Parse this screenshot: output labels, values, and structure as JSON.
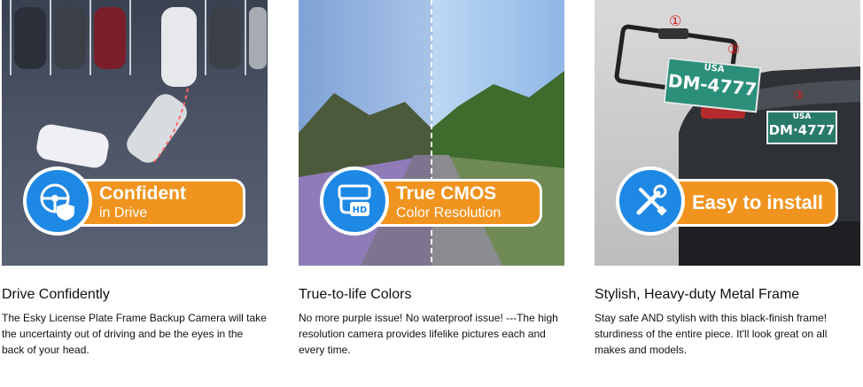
{
  "features": [
    {
      "badge_main": "Confident",
      "badge_sub": "in Drive",
      "title": "Drive Confidently",
      "body": "The Esky License Plate Frame Backup Camera will take the uncertainty out of driving and be the eyes in the back of your head."
    },
    {
      "badge_main": "True CMOS",
      "badge_sub": "Color Resolution",
      "title": "True-to-life Colors",
      "body": "No more purple issue! No waterproof issue! ---The high resolution camera provides lifelike pictures each and every time."
    },
    {
      "badge_main": "Easy to install",
      "title": "Stylish, Heavy-duty Metal Frame",
      "body": "Stay safe AND stylish with this black-finish frame! sturdiness of the entire piece. It'll look great on all makes and models."
    }
  ],
  "plates": {
    "country": "USA",
    "number": "DM-4777",
    "number_small": "DM·4777"
  },
  "step_markers": [
    "①",
    "②",
    "③"
  ],
  "icons": [
    "steering-wheel-shield-icon",
    "camera-hd-icon",
    "wrench-screwdriver-icon"
  ],
  "colors": {
    "badge_orange": "#f0941f",
    "badge_blue": "#1e88e5",
    "plate_green": "#2b8f7a"
  }
}
